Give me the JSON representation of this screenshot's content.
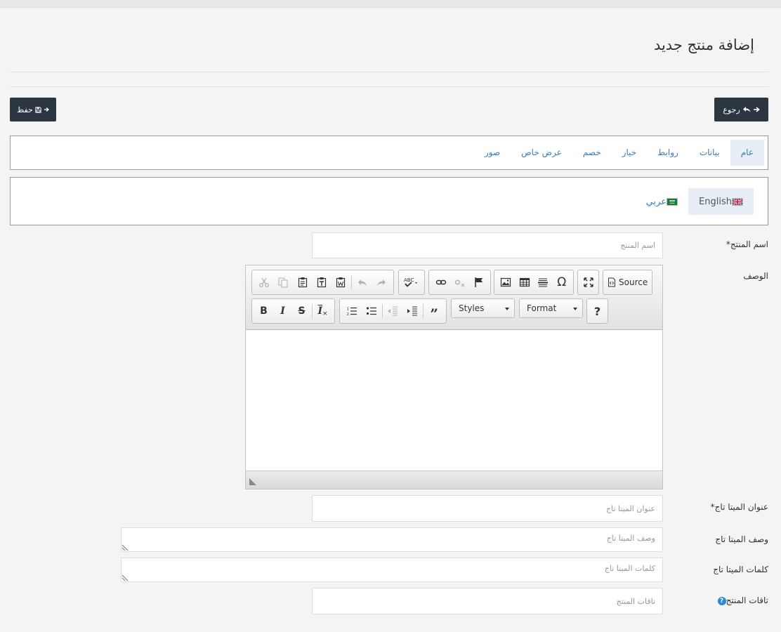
{
  "page": {
    "title": "إضافة منتج جديد"
  },
  "toolbar": {
    "back_label": "رجوع",
    "save_label": "حفظ"
  },
  "tabs": [
    {
      "label": "عام",
      "active": true
    },
    {
      "label": "بيانات",
      "active": false
    },
    {
      "label": "روابط",
      "active": false
    },
    {
      "label": "خيار",
      "active": false
    },
    {
      "label": "خصم",
      "active": false
    },
    {
      "label": "عرض خاص",
      "active": false
    },
    {
      "label": "صور",
      "active": false
    }
  ],
  "languages": [
    {
      "label": "English",
      "active": true
    },
    {
      "label": "عربي",
      "active": false
    }
  ],
  "form": {
    "product_name": {
      "label": "اسم المنتج*",
      "placeholder": "اسم المنتج",
      "value": ""
    },
    "description": {
      "label": "الوصف"
    },
    "meta_title": {
      "label": "عنوان الميتا تاج*",
      "placeholder": "عنوان الميتا تاج",
      "value": ""
    },
    "meta_description": {
      "label": "وصف الميتا تاج",
      "placeholder": "وصف الميتا تاج",
      "value": ""
    },
    "meta_keywords": {
      "label": "كلمات الميتا تاج",
      "placeholder": "كلمات الميتا تاج",
      "value": ""
    },
    "product_tags": {
      "label": "تاقات المنتج",
      "placeholder": "تاقات المنتج",
      "value": ""
    }
  },
  "editor": {
    "source_label": "Source",
    "styles_label": "Styles",
    "format_label": "Format",
    "help_label": "?",
    "bold_label": "B",
    "italic_label": "I",
    "strike_label": "S",
    "remove_format_label": "I",
    "omega_label": "Ω",
    "icons": [
      "cut-icon",
      "copy-icon",
      "paste-icon",
      "paste-text-icon",
      "paste-word-icon",
      "undo-icon",
      "redo-icon",
      "spellcheck-icon",
      "link-icon",
      "unlink-icon",
      "anchor-icon",
      "image-icon",
      "table-icon",
      "horizontal-line-icon",
      "special-char-icon",
      "maximize-icon",
      "source-icon",
      "numbered-list-icon",
      "bullet-list-icon",
      "outdent-icon",
      "indent-icon",
      "blockquote-icon"
    ]
  },
  "colors": {
    "dark_button": "#2b3640",
    "link": "#3a7fb8",
    "active_tab_bg": "#e8eef6",
    "help_icon": "#2d8bd0"
  }
}
